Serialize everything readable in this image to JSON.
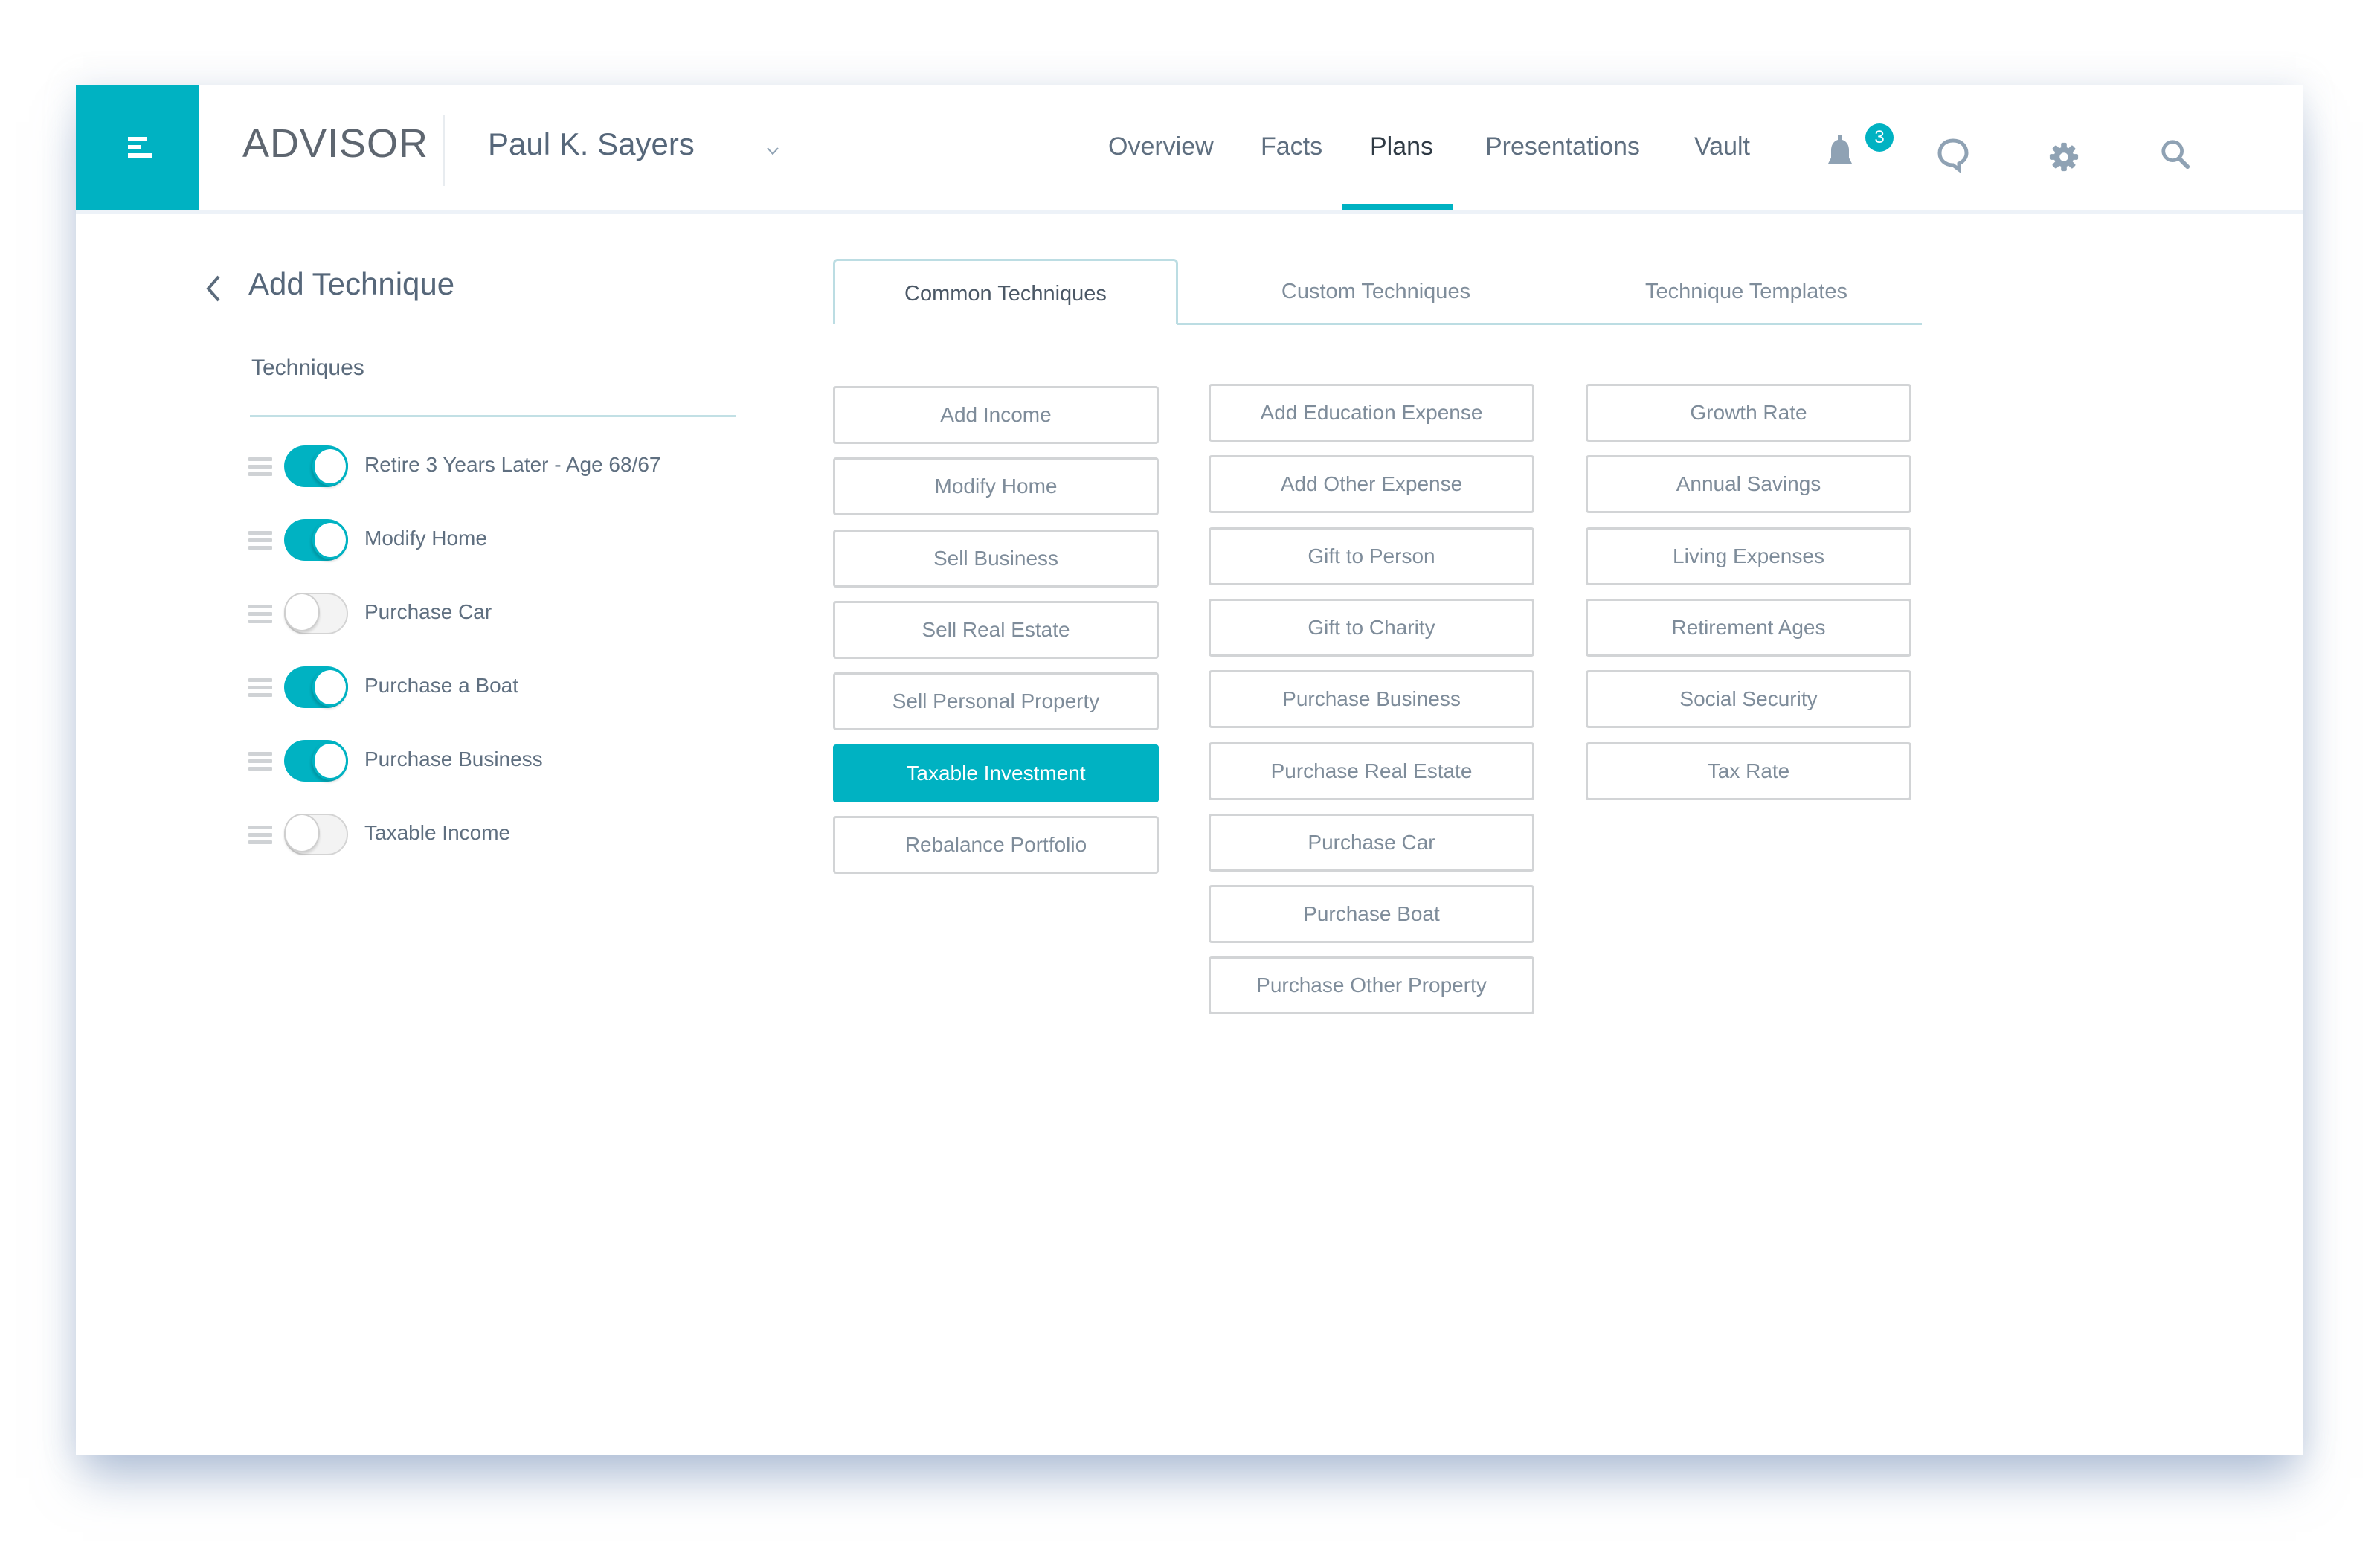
{
  "header": {
    "brand": "ADVISOR",
    "client_name": "Paul K. Sayers",
    "nav": [
      {
        "label": "Overview",
        "active": false
      },
      {
        "label": "Facts",
        "active": false
      },
      {
        "label": "Plans",
        "active": true
      },
      {
        "label": "Presentations",
        "active": false
      },
      {
        "label": "Vault",
        "active": false
      }
    ],
    "notifications_count": "3",
    "icons": [
      "menu-icon",
      "chevron-down-icon",
      "bell-icon",
      "chat-icon",
      "gear-icon",
      "search-icon"
    ]
  },
  "page": {
    "title": "Add Technique",
    "back_icon": "chevron-left-icon"
  },
  "techniques": {
    "label": "Techniques",
    "items": [
      {
        "label": "Retire 3 Years Later - Age 68/67",
        "enabled": true
      },
      {
        "label": "Modify Home",
        "enabled": true
      },
      {
        "label": "Purchase Car",
        "enabled": false
      },
      {
        "label": "Purchase a Boat",
        "enabled": true
      },
      {
        "label": "Purchase Business",
        "enabled": true
      },
      {
        "label": "Taxable Income",
        "enabled": false
      }
    ]
  },
  "tabs": [
    {
      "label": "Common Techniques",
      "active": true
    },
    {
      "label": "Custom Techniques",
      "active": false
    },
    {
      "label": "Technique Templates",
      "active": false
    }
  ],
  "technique_buttons": {
    "columns": [
      [
        "Add Income",
        "Modify Home",
        "Sell Business",
        "Sell Real Estate",
        "Sell Personal Property",
        "Taxable Investment",
        "Rebalance Portfolio"
      ],
      [
        "Add Education Expense",
        "Add Other Expense",
        "Gift to Person",
        "Gift to Charity",
        "Purchase Business",
        "Purchase Real Estate",
        "Purchase Car",
        "Purchase Boat",
        "Purchase Other Property"
      ],
      [
        "Growth Rate",
        "Annual Savings",
        "Living Expenses",
        "Retirement Ages",
        "Social Security",
        "Tax Rate"
      ]
    ],
    "selected": "Taxable Investment"
  },
  "colors": {
    "accent": "#00b2c2",
    "text": "#5f6f80",
    "border": "#d2d4d6",
    "icon": "#8fa2b4"
  }
}
